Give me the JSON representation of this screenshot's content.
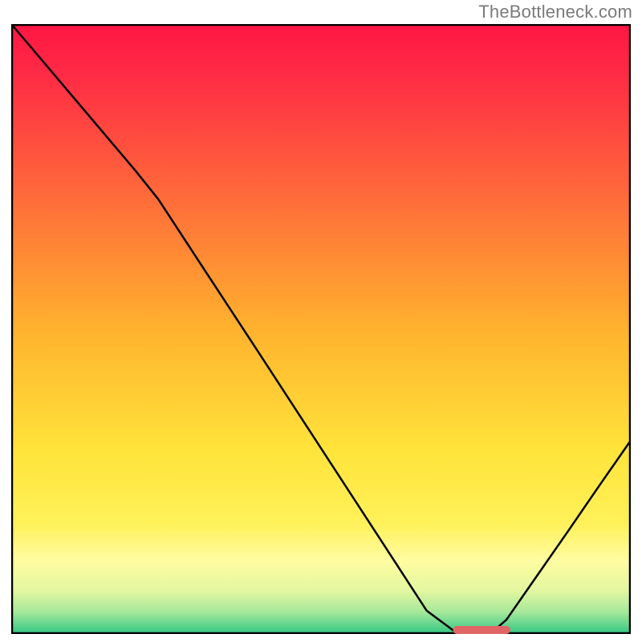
{
  "watermark": "TheBottleneck.com",
  "chart_data": {
    "type": "line",
    "title": "",
    "xlabel": "",
    "ylabel": "",
    "xlim": [
      0,
      100
    ],
    "ylim": [
      0,
      100
    ],
    "grid": false,
    "legend": false,
    "note": "No axis tick labels present; x and y values are normalized 0–100 from plot-area pixel coordinates.",
    "series": [
      {
        "name": "curve",
        "color": "#000000",
        "x": [
          0.0,
          5.0,
          10.0,
          15.0,
          20.0,
          23.7,
          30.0,
          40.0,
          50.0,
          60.0,
          67.1,
          72.0,
          77.5,
          80.0,
          85.0,
          90.0,
          95.0,
          100.0
        ],
        "y": [
          100.0,
          94.0,
          88.0,
          82.0,
          76.0,
          71.3,
          61.5,
          46.0,
          30.4,
          14.8,
          3.7,
          0.0,
          0.0,
          2.2,
          9.5,
          16.8,
          24.2,
          31.5
        ]
      }
    ],
    "optimal_marker": {
      "type": "segment",
      "color": "#e06666",
      "thickness_px": 10,
      "x_range": [
        72.0,
        80.0
      ],
      "y": 0.0
    },
    "background_gradient": {
      "stops": [
        {
          "pos": 0.0,
          "color": "#ff1744"
        },
        {
          "pos": 0.08,
          "color": "#ff2a45"
        },
        {
          "pos": 0.28,
          "color": "#ff6a3a"
        },
        {
          "pos": 0.5,
          "color": "#ffb22e"
        },
        {
          "pos": 0.7,
          "color": "#ffe43a"
        },
        {
          "pos": 0.82,
          "color": "#fff15a"
        },
        {
          "pos": 0.88,
          "color": "#fffca0"
        },
        {
          "pos": 0.93,
          "color": "#e3f7a0"
        },
        {
          "pos": 0.965,
          "color": "#a6e89a"
        },
        {
          "pos": 1.0,
          "color": "#35c985"
        }
      ]
    },
    "frame_color": "#000000"
  }
}
